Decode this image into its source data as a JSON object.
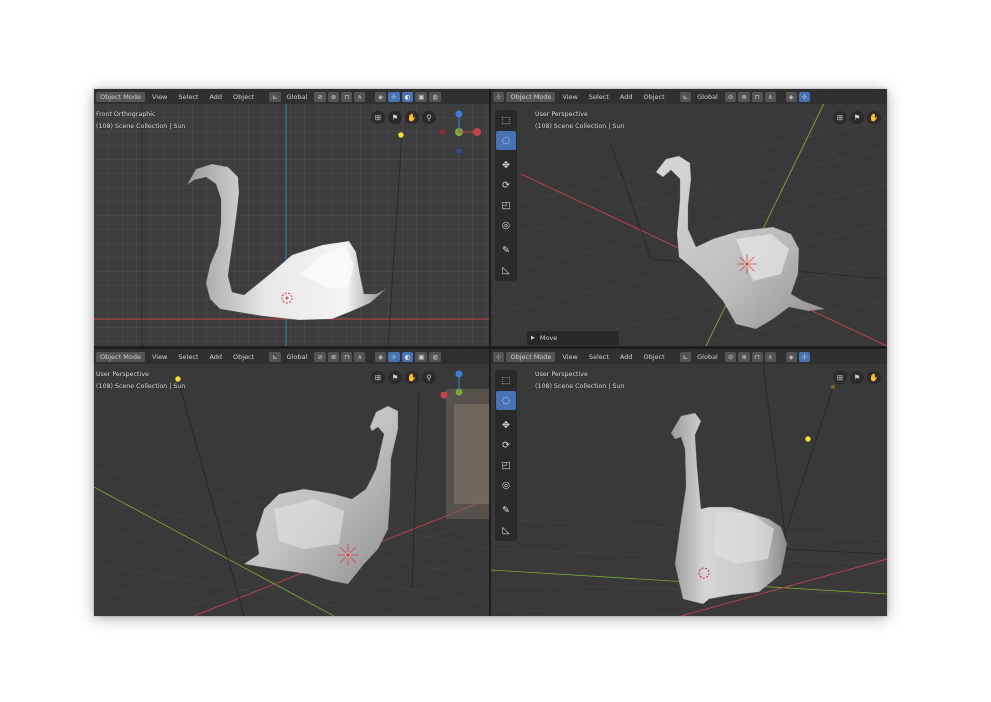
{
  "header": {
    "object_mode": "Object Mode",
    "menu_view": "View",
    "menu_select": "Select",
    "menu_add": "Add",
    "menu_object": "Object",
    "orientation": "Global"
  },
  "viewports": [
    {
      "view_name": "Front Orthographic",
      "collection": "(108) Scene Collection | Sun"
    },
    {
      "view_name": "User Perspective",
      "collection": "(108) Scene Collection | Sun"
    },
    {
      "view_name": "User Perspective",
      "collection": "(108) Scene Collection | Sun"
    },
    {
      "view_name": "User Perspective",
      "collection": "(108) Scene Collection | Sun"
    }
  ],
  "last_operator": "Move",
  "tools": [
    "select-box-tool",
    "cursor-tool",
    "move-tool",
    "rotate-tool",
    "scale-tool",
    "transform-tool",
    "annotate-tool",
    "measure-tool"
  ],
  "colors": {
    "viewport_bg": "#3d3d3d",
    "header_bg": "#303030",
    "active_blue": "#4772b3",
    "axis_x_red": "#c6414e",
    "axis_y_green": "#7ea934",
    "axis_z_blue": "#3d7fd0",
    "light_yellow": "#f4e22c",
    "mesh_white": "#e6e6e6"
  }
}
